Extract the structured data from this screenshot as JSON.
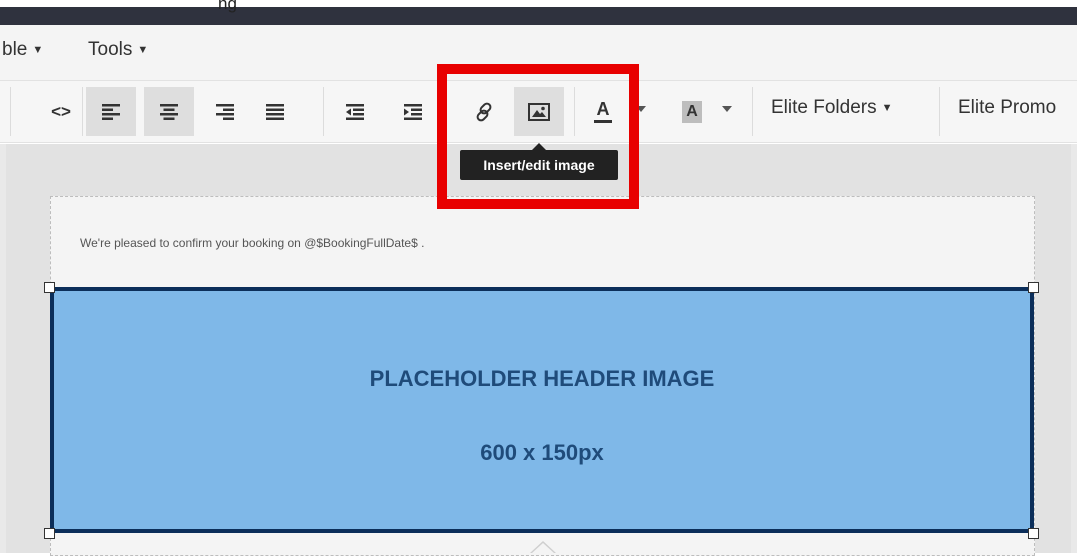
{
  "topbar": {
    "text": "ng"
  },
  "menubar": {
    "items": [
      {
        "label": "ble"
      },
      {
        "label": "Tools"
      }
    ]
  },
  "toolbar": {
    "code_label": "<>",
    "buttons": [
      {
        "name": "source-code",
        "icon": "code-icon"
      },
      {
        "name": "align-left",
        "icon": "align-left-icon",
        "active": true
      },
      {
        "name": "align-center",
        "icon": "align-center-icon",
        "active": true
      },
      {
        "name": "align-right",
        "icon": "align-right-icon"
      },
      {
        "name": "align-justify",
        "icon": "align-justify-icon"
      },
      {
        "name": "outdent",
        "icon": "outdent-icon"
      },
      {
        "name": "indent",
        "icon": "indent-icon"
      },
      {
        "name": "link",
        "icon": "link-icon"
      },
      {
        "name": "insert-image",
        "icon": "image-icon",
        "active": true
      },
      {
        "name": "text-color",
        "icon": "text-color-icon"
      },
      {
        "name": "background-color",
        "icon": "background-color-icon"
      }
    ],
    "text_color_letter": "A",
    "bg_color_letter": "A",
    "elite_folders_label": "Elite Folders",
    "elite_promo_label": "Elite Promo"
  },
  "tooltip": {
    "text": "Insert/edit image"
  },
  "highlight_color": "#e80000",
  "editor": {
    "confirm_text": "We're pleased to confirm your booking on @$BookingFullDate$ .",
    "placeholder": {
      "title": "PLACEHOLDER HEADER IMAGE",
      "size": "600 x 150px",
      "fill_color": "#7fb8e8",
      "border_color": "#0b2e5a"
    }
  }
}
